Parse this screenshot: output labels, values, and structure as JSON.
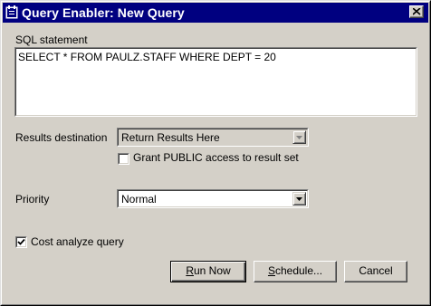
{
  "window": {
    "title": "Query Enabler: New Query"
  },
  "icons": {
    "app": "query-app-icon",
    "close": "close-icon",
    "dropdown": "chevron-down-icon",
    "check": "checkmark-icon"
  },
  "sql": {
    "label": "SQL statement",
    "value": "SELECT * FROM PAULZ.STAFF WHERE DEPT = 20"
  },
  "results_destination": {
    "label": "Results destination",
    "selected": "Return Results Here",
    "enabled": false
  },
  "grant_public": {
    "label": "Grant PUBLIC access to result set",
    "checked": false
  },
  "priority": {
    "label": "Priority",
    "selected": "Normal"
  },
  "cost_analyze": {
    "label": "Cost analyze query",
    "checked": true
  },
  "buttons": {
    "run_now": {
      "mnemonic": "R",
      "rest": "un Now"
    },
    "schedule": {
      "mnemonic": "S",
      "rest": "chedule..."
    },
    "cancel": "Cancel"
  },
  "colors": {
    "titlebar": "#000080",
    "face": "#d4d0c8",
    "field": "#ffffff",
    "disabled_field": "#d4d0c8"
  }
}
